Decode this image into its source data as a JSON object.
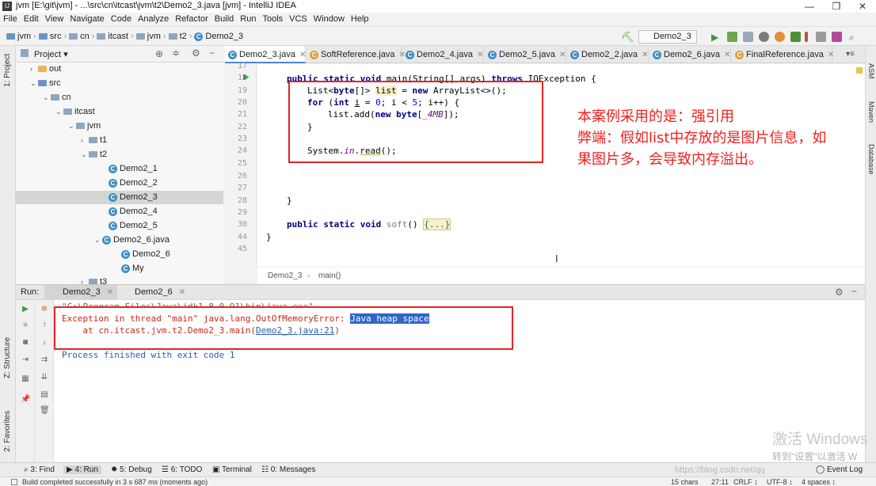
{
  "window": {
    "title": "jvm [E:\\git\\jvm] - ...\\src\\cn\\itcast\\jvm\\t2\\Demo2_3.java [jvm] - IntelliJ IDEA"
  },
  "menu": [
    "File",
    "Edit",
    "View",
    "Navigate",
    "Code",
    "Analyze",
    "Refactor",
    "Build",
    "Run",
    "Tools",
    "VCS",
    "Window",
    "Help"
  ],
  "breadcrumbs": [
    "jvm",
    "src",
    "cn",
    "itcast",
    "jvm",
    "t2",
    "Demo2_3"
  ],
  "run_config": "Demo2_3",
  "project_panel": {
    "title": "Project",
    "side_label": "1: Project",
    "tree": [
      {
        "label": "out",
        "arrow": "›"
      },
      {
        "label": "src",
        "arrow": "⌄"
      },
      {
        "label": "cn",
        "arrow": "⌄"
      },
      {
        "label": "itcast",
        "arrow": "⌄"
      },
      {
        "label": "jvm",
        "arrow": "⌄"
      },
      {
        "label": "t1",
        "arrow": "›"
      },
      {
        "label": "t2",
        "arrow": "⌄"
      },
      {
        "label": "Demo2_1",
        "arrow": ""
      },
      {
        "label": "Demo2_2",
        "arrow": ""
      },
      {
        "label": "Demo2_3",
        "arrow": ""
      },
      {
        "label": "Demo2_4",
        "arrow": ""
      },
      {
        "label": "Demo2_5",
        "arrow": ""
      },
      {
        "label": "Demo2_6.java",
        "arrow": "⌄"
      },
      {
        "label": "Demo2_6",
        "arrow": ""
      },
      {
        "label": "My",
        "arrow": ""
      },
      {
        "label": "t3",
        "arrow": "›"
      }
    ]
  },
  "editor": {
    "tabs": [
      "Demo2_3.java",
      "SoftReference.java",
      "Demo2_4.java",
      "Demo2_5.java",
      "Demo2_2.java",
      "Demo2_6.java",
      "FinalReference.java"
    ],
    "line_numbers": [
      "17",
      "18",
      "19",
      "20",
      "21",
      "22",
      "23",
      "24",
      "25",
      "26",
      "27",
      "28",
      "29",
      "30",
      "44",
      "45"
    ],
    "code": {
      "l18": [
        "public static void ",
        "main",
        "(String[] args) ",
        "throws ",
        "IOException {"
      ],
      "l19": [
        "List<",
        "byte",
        "[]> ",
        "list",
        " = ",
        "new ",
        "ArrayList<>();"
      ],
      "l20": [
        "for ",
        "(",
        "int ",
        "i",
        " = ",
        "0",
        "; i < ",
        "5",
        "; i++) {"
      ],
      "l21": [
        "list.add(",
        "new ",
        "byte",
        "[",
        "_4MB",
        "]);"
      ],
      "l22": [
        "}"
      ],
      "l24": [
        "System.",
        "in",
        ".",
        "read",
        "();"
      ],
      "l28": [
        "}"
      ],
      "l30": [
        "public static void ",
        "soft",
        "() ",
        "{...}"
      ],
      "l44": [
        "}"
      ]
    },
    "breadcrumb": [
      "Demo2_3",
      "main()"
    ]
  },
  "annotation": {
    "line1": "本案例采用的是：强引用",
    "line2": "弊端：假如list中存放的是图片信息，如",
    "line3": "果图片多，会导致内存溢出。"
  },
  "run_panel": {
    "label": "Run:",
    "tabs": [
      "Demo2_3",
      "Demo2_6"
    ],
    "console": {
      "cmd": "\"C:\\Program Files\\Java\\jdk1.8.0_91\\bin\\java.exe\" ...",
      "err_prefix": "Exception in thread \"main\" java.lang.OutOfMemoryError: ",
      "err_highlight": "Java heap space",
      "at_prefix": "    at cn.itcast.jvm.t2.Demo2_3.main(",
      "at_link": "Demo2_3.java:21",
      "at_suffix": ")",
      "exit": "Process finished with exit code 1"
    }
  },
  "left_strip": [
    "1: Project",
    "Z: Structure",
    "2: Favorites"
  ],
  "right_strip": [
    "ASM",
    "Maven",
    "Database"
  ],
  "bottom_tools": [
    "3: Find",
    "4: Run",
    "5: Debug",
    "6: TODO",
    "Terminal",
    "0: Messages",
    "Event Log"
  ],
  "status": {
    "message": "Build completed successfully in 3 s 687 ms (moments ago)",
    "chars": "15 chars",
    "pos": "27:11",
    "crlf": "CRLF",
    "enc": "UTF-8",
    "indent": "4 spaces"
  },
  "watermark": {
    "activate": "激活 Windows",
    "activate_sub": "转到\"设置\"以激活 W",
    "url": "https://blog.csdn.net/qq"
  }
}
